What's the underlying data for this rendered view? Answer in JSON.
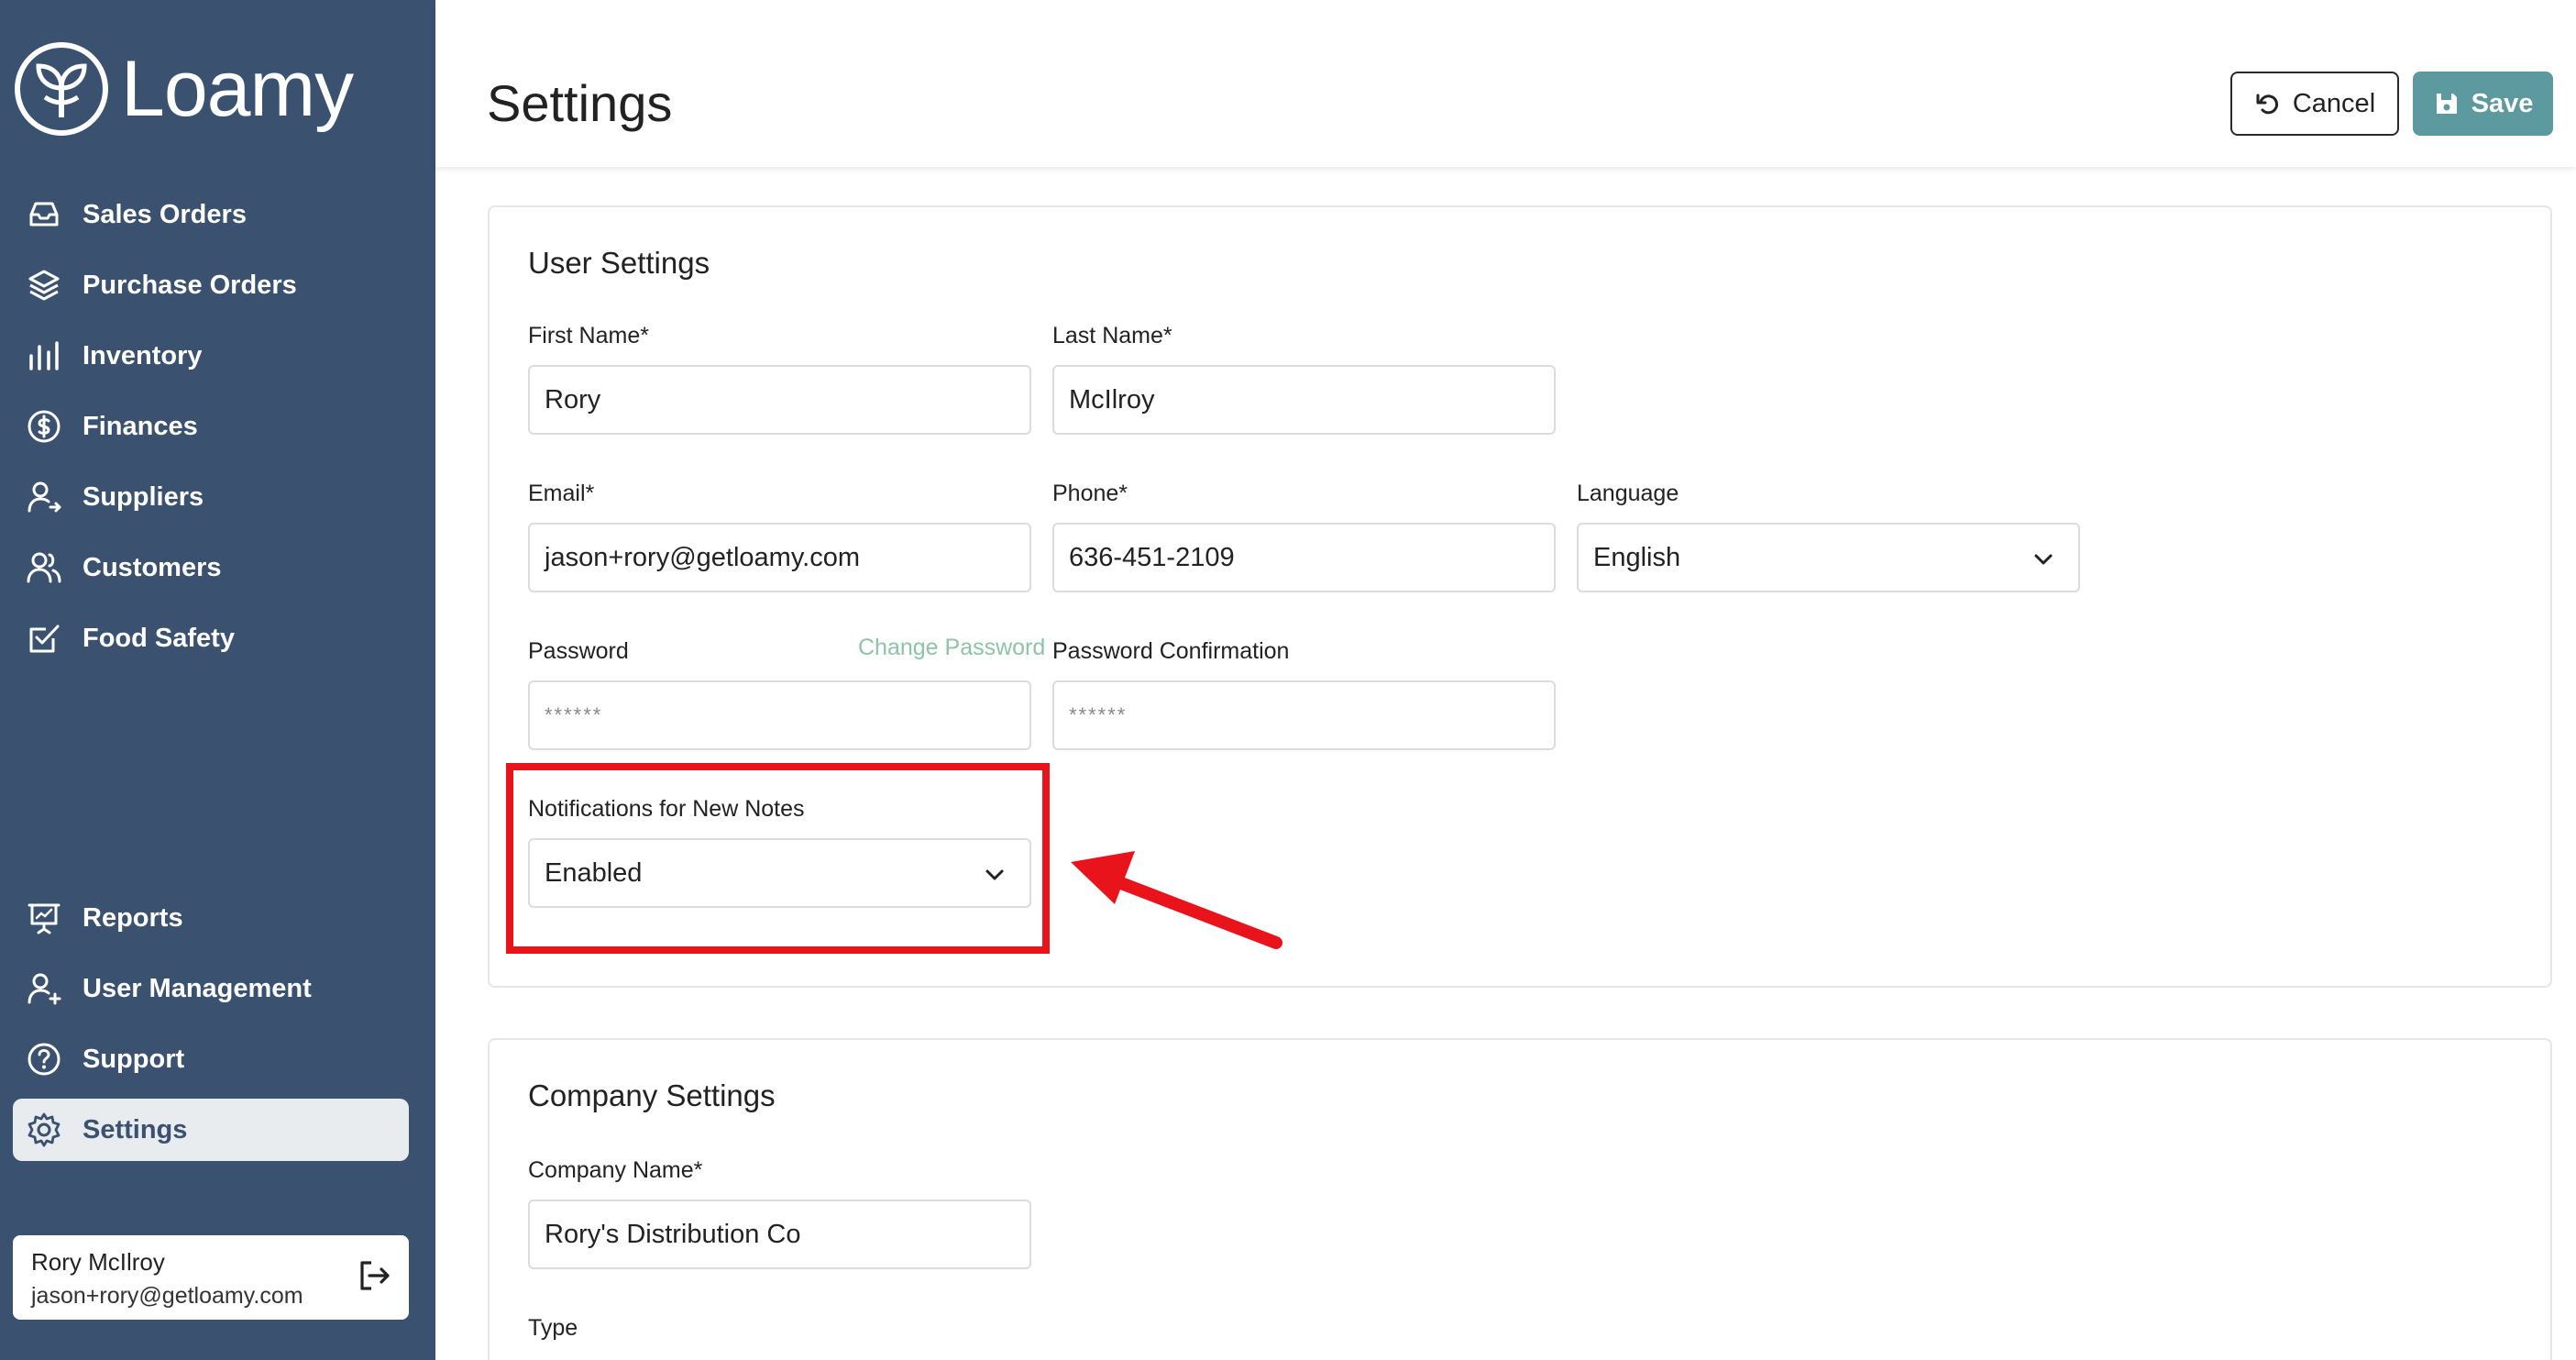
{
  "app": {
    "name": "Loamy"
  },
  "sidebar": {
    "items": [
      {
        "label": "Sales Orders",
        "icon": "inbox-icon"
      },
      {
        "label": "Purchase Orders",
        "icon": "layers-icon"
      },
      {
        "label": "Inventory",
        "icon": "bars-icon"
      },
      {
        "label": "Finances",
        "icon": "dollar-circle-icon"
      },
      {
        "label": "Suppliers",
        "icon": "user-arrow-icon"
      },
      {
        "label": "Customers",
        "icon": "users-icon"
      },
      {
        "label": "Food Safety",
        "icon": "checkbox-edit-icon"
      },
      {
        "label": "Reports",
        "icon": "presentation-icon"
      },
      {
        "label": "User Management",
        "icon": "user-plus-icon"
      },
      {
        "label": "Support",
        "icon": "question-circle-icon"
      },
      {
        "label": "Settings",
        "icon": "gear-icon",
        "active": true
      }
    ],
    "user": {
      "name": "Rory McIlroy",
      "email": "jason+rory@getloamy.com"
    }
  },
  "header": {
    "title": "Settings",
    "cancel_label": "Cancel",
    "save_label": "Save"
  },
  "user_settings": {
    "title": "User Settings",
    "first_name": {
      "label": "First Name*",
      "value": "Rory"
    },
    "last_name": {
      "label": "Last Name*",
      "value": "McIlroy"
    },
    "email": {
      "label": "Email*",
      "value": "jason+rory@getloamy.com"
    },
    "phone": {
      "label": "Phone*",
      "value": "636-451-2109"
    },
    "language": {
      "label": "Language",
      "value": "English"
    },
    "password": {
      "label": "Password",
      "change_link": "Change Password",
      "value": "******"
    },
    "password_confirmation": {
      "label": "Password Confirmation",
      "value": "******"
    },
    "notifications": {
      "label": "Notifications for New Notes",
      "value": "Enabled"
    }
  },
  "company_settings": {
    "title": "Company Settings",
    "company_name": {
      "label": "Company Name*",
      "value": "Rory's Distribution Co"
    },
    "type": {
      "label": "Type"
    }
  },
  "colors": {
    "sidebar_bg": "#3a5170",
    "save_button": "#5d9a9f",
    "link": "#8cc5a3",
    "highlight": "#e8131b"
  }
}
